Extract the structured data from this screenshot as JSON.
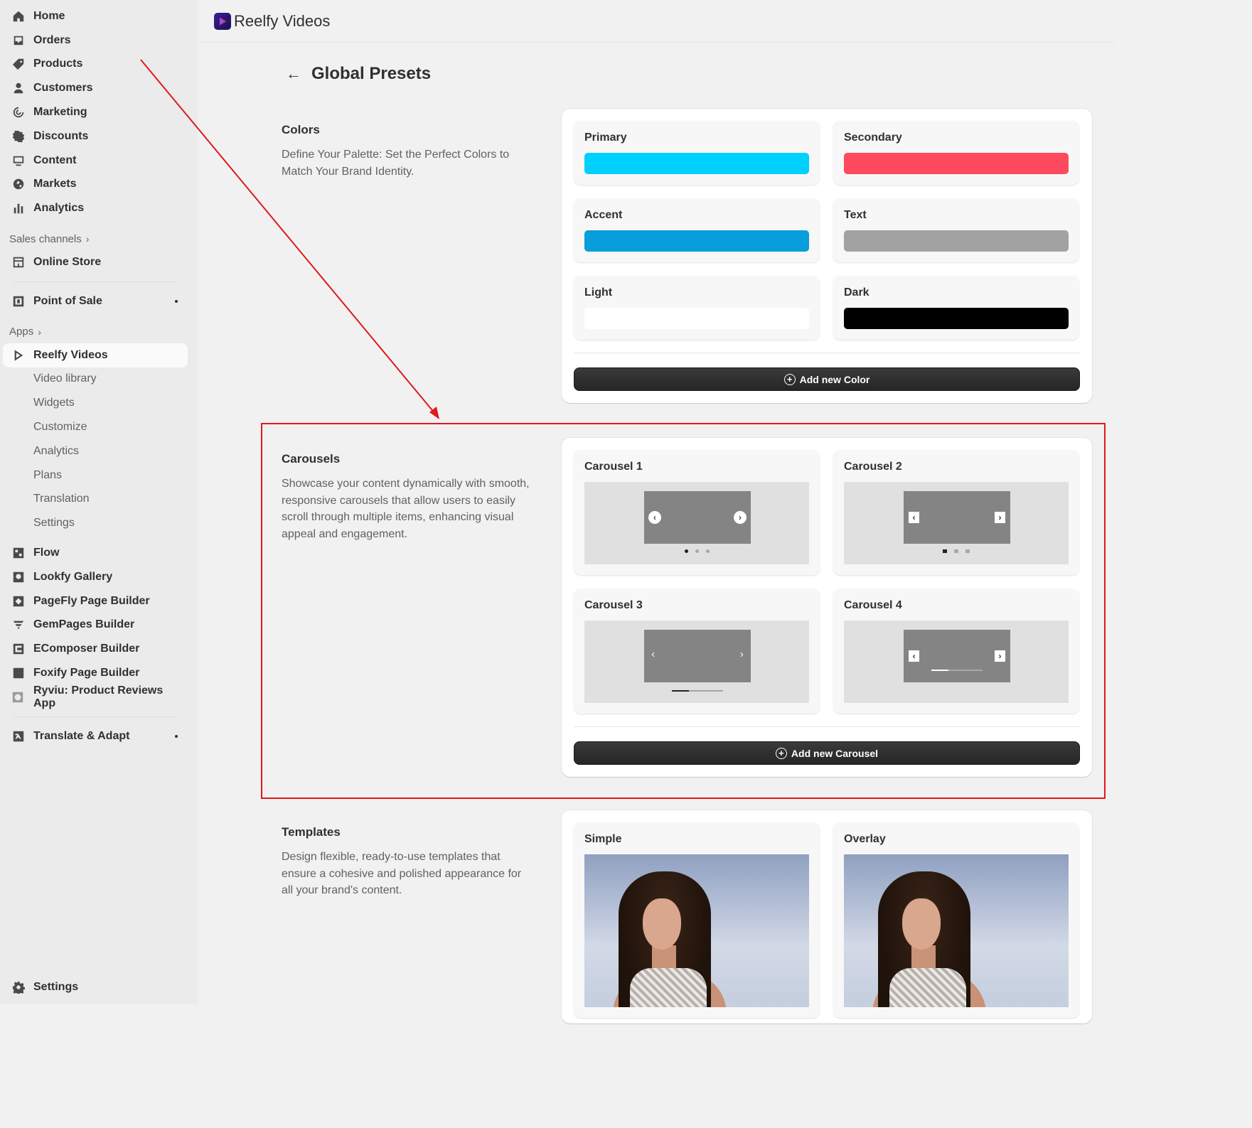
{
  "sidebar": {
    "main_items": [
      {
        "label": "Home",
        "icon": "home-icon"
      },
      {
        "label": "Orders",
        "icon": "inbox-icon"
      },
      {
        "label": "Products",
        "icon": "tag-icon"
      },
      {
        "label": "Customers",
        "icon": "person-icon"
      },
      {
        "label": "Marketing",
        "icon": "target-icon"
      },
      {
        "label": "Discounts",
        "icon": "discount-icon"
      },
      {
        "label": "Content",
        "icon": "content-icon"
      },
      {
        "label": "Markets",
        "icon": "globe-icon"
      },
      {
        "label": "Analytics",
        "icon": "bar-chart-icon"
      }
    ],
    "sales_channels_label": "Sales channels",
    "online_store": "Online Store",
    "point_of_sale": "Point of Sale",
    "apps_label": "Apps",
    "reelfy_videos": "Reelfy Videos",
    "reelfy_sub": [
      "Video library",
      "Widgets",
      "Customize",
      "Analytics",
      "Plans",
      "Translation",
      "Settings"
    ],
    "other_apps": [
      {
        "label": "Flow",
        "icon": "flow-icon"
      },
      {
        "label": "Lookfy Gallery",
        "icon": "lookfy-icon"
      },
      {
        "label": "PageFly Page Builder",
        "icon": "pagefly-icon"
      },
      {
        "label": "GemPages Builder",
        "icon": "gempages-icon"
      },
      {
        "label": "EComposer Builder",
        "icon": "ecomposer-icon"
      },
      {
        "label": "Foxify Page Builder",
        "icon": "foxify-icon"
      },
      {
        "label": "Ryviu: Product Reviews App",
        "icon": "ryviu-icon"
      }
    ],
    "translate_adapt": "Translate & Adapt",
    "settings": "Settings"
  },
  "topbar": {
    "app_title": "Reelfy Videos"
  },
  "page": {
    "title": "Global Presets"
  },
  "colors_section": {
    "heading": "Colors",
    "description": "Define Your Palette: Set the Perfect Colors to Match Your Brand Identity.",
    "swatches": [
      {
        "label": "Primary",
        "color": "#00d0fc"
      },
      {
        "label": "Secondary",
        "color": "#fe4a5e"
      },
      {
        "label": "Accent",
        "color": "#089ddb"
      },
      {
        "label": "Text",
        "color": "#a2a2a2"
      },
      {
        "label": "Light",
        "color": "#ffffff"
      },
      {
        "label": "Dark",
        "color": "#000000"
      }
    ],
    "add_button": "Add new Color"
  },
  "carousels_section": {
    "heading": "Carousels",
    "description": "Showcase your content dynamically with smooth, responsive carousels that allow users to easily scroll through multiple items, enhancing visual appeal and engagement.",
    "items": [
      "Carousel 1",
      "Carousel 2",
      "Carousel 3",
      "Carousel 4"
    ],
    "add_button": "Add new Carousel"
  },
  "templates_section": {
    "heading": "Templates",
    "description": "Design flexible, ready-to-use templates that ensure a cohesive and polished appearance for all your brand's content.",
    "items": [
      "Simple",
      "Overlay"
    ]
  },
  "annotation_color": "#e0191c"
}
